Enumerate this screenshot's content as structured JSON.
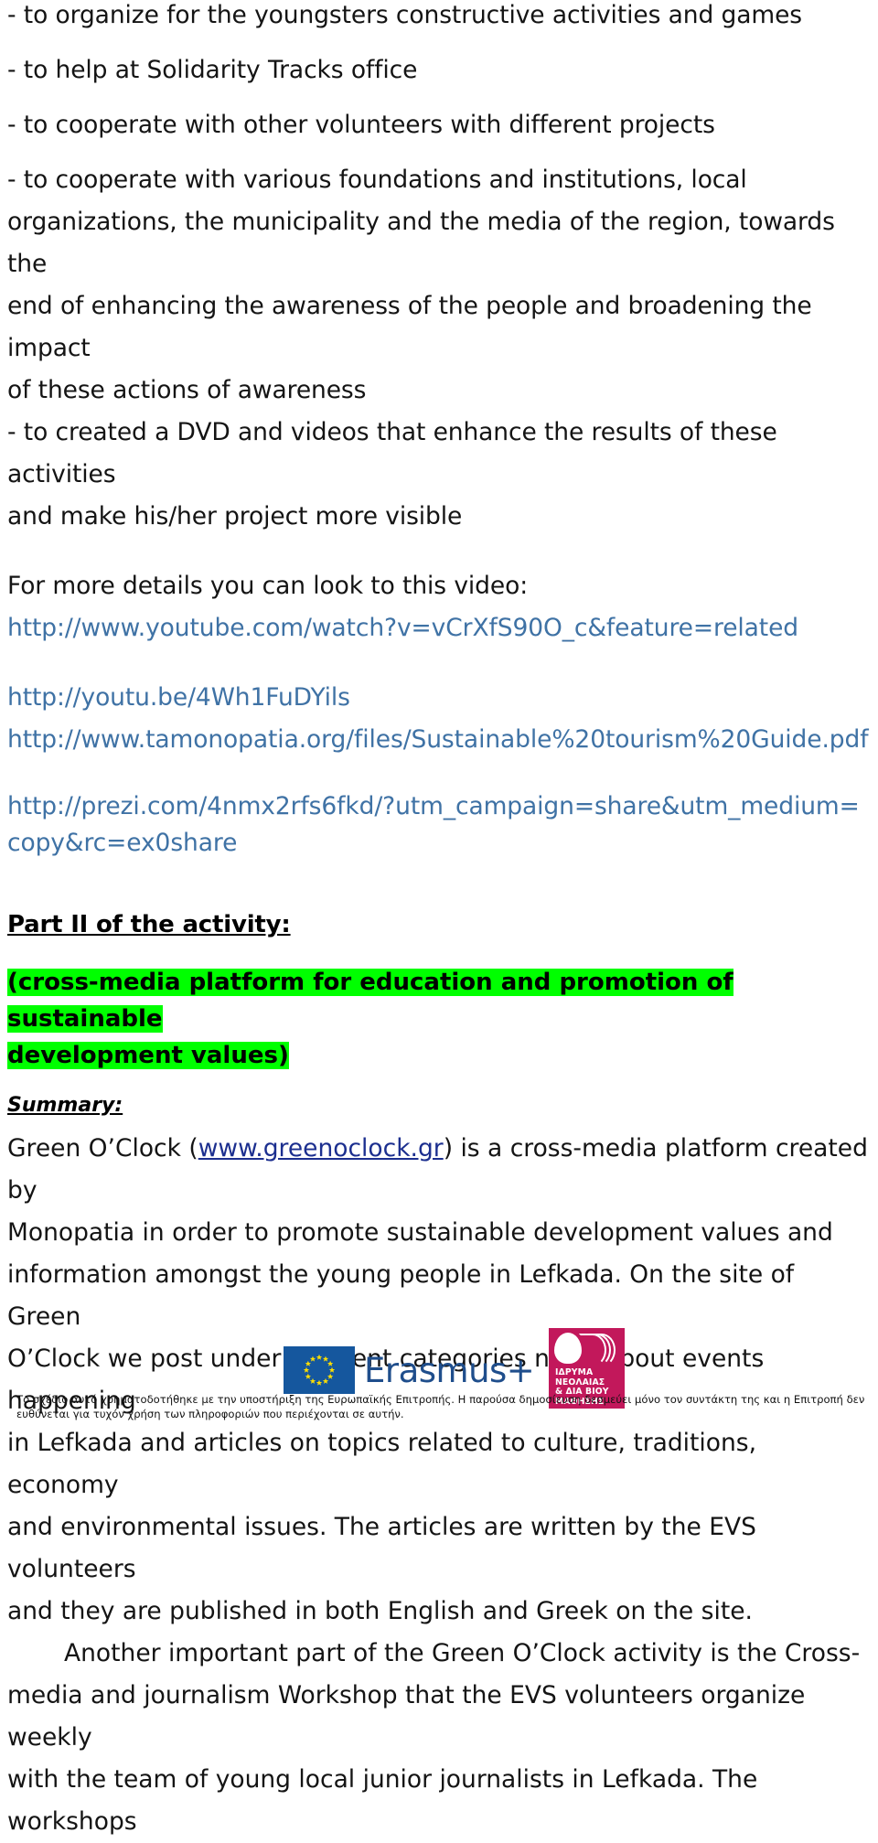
{
  "document": {
    "bullets": [
      "- to organize for the youngsters constructive activities and games",
      "- to help at Solidarity Tracks office",
      "- to cooperate with other volunteers with different projects"
    ],
    "paragraph_cooperate": {
      "line1": "-   to   cooperate   with   various   foundations   and   institutions,   local",
      "line2": "organizations, the municipality and the media of the region, towards the",
      "line3": "end of enhancing the awareness of the people and broadening the impact",
      "line4": "of these actions of awareness"
    },
    "bullet_dvd": {
      "line1": "- to created a DVD and videos that enhance the results of these activities",
      "line2": "and make his/her project more visible"
    },
    "video_intro": "For more details you can look to this video:",
    "links": [
      "http://www.youtube.com/watch?v=vCrXfS90O_c&feature=related",
      "http://youtu.be/4Wh1FuDYils",
      "http://www.tamonopatia.org/files/Sustainable%20tourism%20Guide.pdf",
      "http://prezi.com/4nmx2rfs6fkd/?utm_campaign=share&utm_medium=copy&rc=ex0share"
    ],
    "part_two_heading": "Part II of the activity:",
    "highlight_line1": "(cross-media platform for education and promotion of sustainable",
    "highlight_line2": "development values)",
    "summary_label": "Summary:",
    "summary": {
      "lead_before_link": "Green O’Clock (",
      "link_text": "www.greenoclock.gr",
      "lead_after_link": ") is a cross-media platform created by",
      "line2": "Monopatia  in  order  to  promote  sustainable  development  values  and",
      "line3": "information amongst the young people in Lefkada.  On the site of Green",
      "line4": "O’Clock we post under different categories news about events happening",
      "line5": "in Lefkada and articles on topics related to culture, traditions, economy",
      "line6": "and environmental issues. The articles are written by the EVS volunteers",
      "line7": "and they are published in both English and Greek on the site."
    },
    "workshop": {
      "line1": "Another  important  part  of  the  Green  O’Clock  activity  is  the  Cross-",
      "line2": "media and journalism Workshop that the EVS volunteers organize weekly",
      "line3": "with the team of young local junior journalists in Lefkada. The workshops"
    }
  },
  "footer": {
    "erasmus_logo_text": "Erasmus+",
    "iny_logo_lines": [
      "ΙΔΡΥΜΑ",
      "ΝΕΟΛΑΙΑΣ",
      "& ΔΙΑ ΒΙΟΥ",
      "ΜΑΘΗΣΗΣ"
    ],
    "disclaimer": "Το σχέδιο αυτό χρηματοδοτήθηκε με την υποστήριξη της Ευρωπαϊκής Επιτροπής. Η παρούσα δημοσίευση δεσμεύει μόνο τον συντάκτη της και η Επιτροπή δεν ευθύνεται για τυχόν χρήση των πληροφοριών που περιέχονται σε αυτήν."
  },
  "colors": {
    "link_blue": "#3f72a5",
    "link_navy": "#1c2f8f",
    "highlight_green": "#00ff00",
    "erasmus_blue": "#1f4e8c",
    "iny_pink": "#c2185b"
  }
}
